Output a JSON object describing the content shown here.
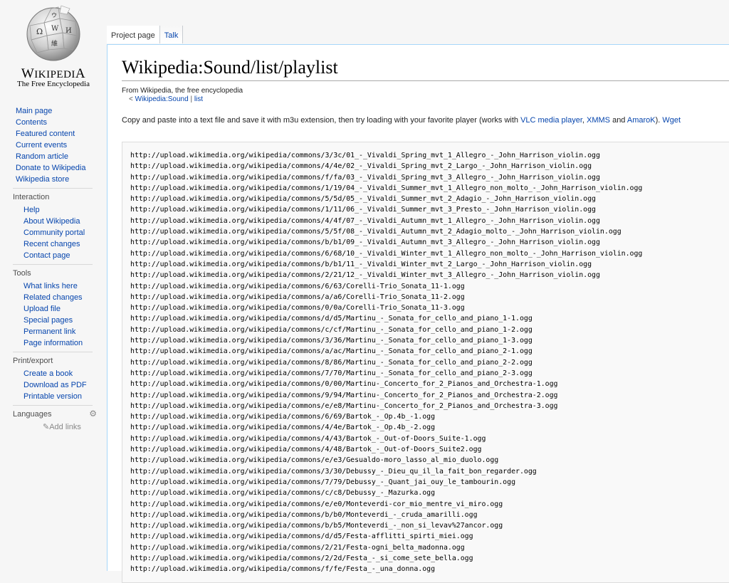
{
  "logo": {
    "wordmark": "Wikipedia",
    "tagline": "The Free Encyclopedia"
  },
  "nav_main": [
    "Main page",
    "Contents",
    "Featured content",
    "Current events",
    "Random article",
    "Donate to Wikipedia",
    "Wikipedia store"
  ],
  "interaction": {
    "heading": "Interaction",
    "items": [
      "Help",
      "About Wikipedia",
      "Community portal",
      "Recent changes",
      "Contact page"
    ]
  },
  "tools": {
    "heading": "Tools",
    "items": [
      "What links here",
      "Related changes",
      "Upload file",
      "Special pages",
      "Permanent link",
      "Page information"
    ]
  },
  "print": {
    "heading": "Print/export",
    "items": [
      "Create a book",
      "Download as PDF",
      "Printable version"
    ]
  },
  "languages": {
    "heading": "Languages",
    "add_links": "Add links"
  },
  "tabs": {
    "project": "Project page",
    "talk": "Talk"
  },
  "page": {
    "title": "Wikipedia:Sound/list/playlist",
    "site_sub": "From Wikipedia, the free encyclopedia",
    "subpages": {
      "prefix": "< ",
      "link1": "Wikipedia:Sound",
      "sep": " | ",
      "link2": "list"
    },
    "intro": {
      "t1": "Copy and paste into a text file and save it with m3u extension, then try loading with your favorite player (works with ",
      "l1": "VLC media player",
      "t2": ", ",
      "l2": "XMMS",
      "t3": " and ",
      "l3": "AmaroK",
      "t4": "). ",
      "l4": "Wget"
    }
  },
  "playlist": [
    "http://upload.wikimedia.org/wikipedia/commons/3/3c/01_-_Vivaldi_Spring_mvt_1_Allegro_-_John_Harrison_violin.ogg",
    "http://upload.wikimedia.org/wikipedia/commons/4/4e/02_-_Vivaldi_Spring_mvt_2_Largo_-_John_Harrison_violin.ogg",
    "http://upload.wikimedia.org/wikipedia/commons/f/fa/03_-_Vivaldi_Spring_mvt_3_Allegro_-_John_Harrison_violin.ogg",
    "http://upload.wikimedia.org/wikipedia/commons/1/19/04_-_Vivaldi_Summer_mvt_1_Allegro_non_molto_-_John_Harrison_violin.ogg",
    "http://upload.wikimedia.org/wikipedia/commons/5/5d/05_-_Vivaldi_Summer_mvt_2_Adagio_-_John_Harrison_violin.ogg",
    "http://upload.wikimedia.org/wikipedia/commons/1/11/06_-_Vivaldi_Summer_mvt_3_Presto_-_John_Harrison_violin.ogg",
    "http://upload.wikimedia.org/wikipedia/commons/4/4f/07_-_Vivaldi_Autumn_mvt_1_Allegro_-_John_Harrison_violin.ogg",
    "http://upload.wikimedia.org/wikipedia/commons/5/5f/08_-_Vivaldi_Autumn_mvt_2_Adagio_molto_-_John_Harrison_violin.ogg",
    "http://upload.wikimedia.org/wikipedia/commons/b/b1/09_-_Vivaldi_Autumn_mvt_3_Allegro_-_John_Harrison_violin.ogg",
    "http://upload.wikimedia.org/wikipedia/commons/6/68/10_-_Vivaldi_Winter_mvt_1_Allegro_non_molto_-_John_Harrison_violin.ogg",
    "http://upload.wikimedia.org/wikipedia/commons/b/b1/11_-_Vivaldi_Winter_mvt_2_Largo_-_John_Harrison_violin.ogg",
    "http://upload.wikimedia.org/wikipedia/commons/2/21/12_-_Vivaldi_Winter_mvt_3_Allegro_-_John_Harrison_violin.ogg",
    "http://upload.wikimedia.org/wikipedia/commons/6/63/Corelli-Trio_Sonata_11-1.ogg",
    "http://upload.wikimedia.org/wikipedia/commons/a/a6/Corelli-Trio_Sonata_11-2.ogg",
    "http://upload.wikimedia.org/wikipedia/commons/0/0a/Corelli-Trio_Sonata_11-3.ogg",
    "http://upload.wikimedia.org/wikipedia/commons/d/d5/Martinu_-_Sonata_for_cello_and_piano_1-1.ogg",
    "http://upload.wikimedia.org/wikipedia/commons/c/cf/Martinu_-_Sonata_for_cello_and_piano_1-2.ogg",
    "http://upload.wikimedia.org/wikipedia/commons/3/36/Martinu_-_Sonata_for_cello_and_piano_1-3.ogg",
    "http://upload.wikimedia.org/wikipedia/commons/a/ac/Martinu_-_Sonata_for_cello_and_piano_2-1.ogg",
    "http://upload.wikimedia.org/wikipedia/commons/8/86/Martinu_-_Sonata_for_cello_and_piano_2-2.ogg",
    "http://upload.wikimedia.org/wikipedia/commons/7/70/Martinu_-_Sonata_for_cello_and_piano_2-3.ogg",
    "http://upload.wikimedia.org/wikipedia/commons/0/00/Martinu-_Concerto_for_2_Pianos_and_Orchestra-1.ogg",
    "http://upload.wikimedia.org/wikipedia/commons/9/94/Martinu-_Concerto_for_2_Pianos_and_Orchestra-2.ogg",
    "http://upload.wikimedia.org/wikipedia/commons/e/e8/Martinu-_Concerto_for_2_Pianos_and_Orchestra-3.ogg",
    "http://upload.wikimedia.org/wikipedia/commons/6/69/Bartok_-_Op.4b_-1.ogg",
    "http://upload.wikimedia.org/wikipedia/commons/4/4e/Bartok_-_Op.4b_-2.ogg",
    "http://upload.wikimedia.org/wikipedia/commons/4/43/Bartok_-_Out-of-Doors_Suite-1.ogg",
    "http://upload.wikimedia.org/wikipedia/commons/4/48/Bartok_-_Out-of-Doors_Suite2.ogg",
    "http://upload.wikimedia.org/wikipedia/commons/e/e3/Gesualdo-moro_lasso_al_mio_duolo.ogg",
    "http://upload.wikimedia.org/wikipedia/commons/3/30/Debussy_-_Dieu_qu_il_la_fait_bon_regarder.ogg",
    "http://upload.wikimedia.org/wikipedia/commons/7/79/Debussy_-_Quant_jai_ouy_le_tambourin.ogg",
    "http://upload.wikimedia.org/wikipedia/commons/c/c8/Debussy_-_Mazurka.ogg",
    "http://upload.wikimedia.org/wikipedia/commons/e/e0/Monteverdi-cor_mio_mentre_vi_miro.ogg",
    "http://upload.wikimedia.org/wikipedia/commons/b/b0/Monteverdi_-_cruda_amarilli.ogg",
    "http://upload.wikimedia.org/wikipedia/commons/b/b5/Monteverdi_-_non_si_levav%27ancor.ogg",
    "http://upload.wikimedia.org/wikipedia/commons/d/d5/Festa-afflitti_spirti_miei.ogg",
    "http://upload.wikimedia.org/wikipedia/commons/2/21/Festa-ogni_belta_madonna.ogg",
    "http://upload.wikimedia.org/wikipedia/commons/2/2d/Festa_-_si_come_sete_bella.ogg",
    "http://upload.wikimedia.org/wikipedia/commons/f/fe/Festa_-_una_donna.ogg"
  ]
}
